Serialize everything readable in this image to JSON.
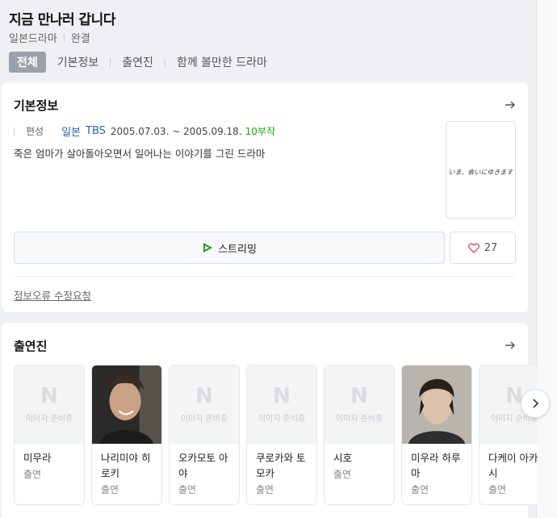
{
  "header": {
    "title": "지금 만나러 갑니다",
    "genre": "일본드라마",
    "status": "완결",
    "tabs": [
      "전체",
      "기본정보",
      "출연진",
      "함께 볼만한 드라마"
    ]
  },
  "basic_info": {
    "title": "기본정보",
    "label": "편성",
    "country": "일본",
    "network": "TBS",
    "period": "2005.07.03. ~ 2005.09.18.",
    "episodes": "10부작",
    "description": "죽은 엄마가 살아돌아오면서 일어나는 이야기를 그린 드라마",
    "poster_text": "いま、会いにゆきます",
    "streaming_label": "스트리밍",
    "like_count": "27",
    "report_link": "정보오류 수정요청"
  },
  "cast": {
    "title": "출연진",
    "placeholder_text": "이미지 준비중",
    "placeholder_letter": "N",
    "members": [
      {
        "name": "미무라",
        "role": "출연"
      },
      {
        "name": "나리미야 히로키",
        "role": "출연"
      },
      {
        "name": "오카모토 아야",
        "role": "출연"
      },
      {
        "name": "쿠로카와 토모카",
        "role": "출연"
      },
      {
        "name": "시호",
        "role": "출연"
      },
      {
        "name": "미우라 하루마",
        "role": "출연"
      },
      {
        "name": "다케이 아카시",
        "role": "출연"
      }
    ]
  },
  "colors": {
    "accent_green": "#1ea21e",
    "link_blue": "#2a66b0",
    "heart_red": "#e0475a",
    "active_tab": "#9aa1aa"
  }
}
